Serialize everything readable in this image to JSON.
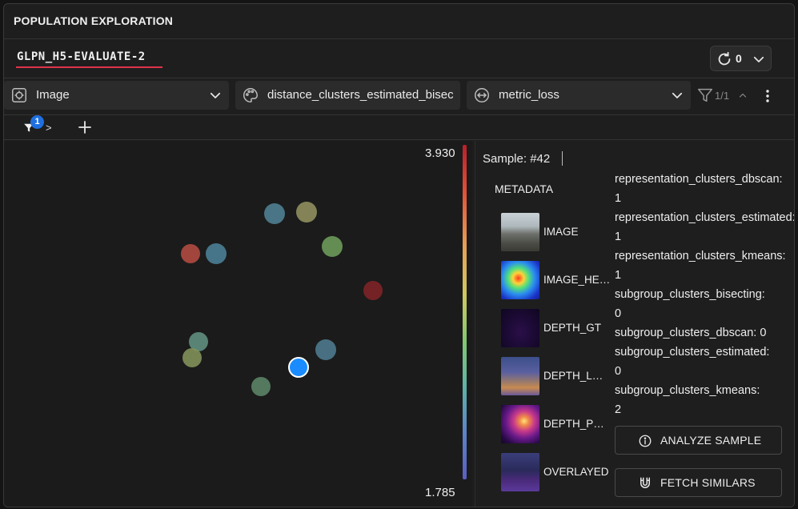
{
  "panel": {
    "title": "POPULATION EXPLORATION"
  },
  "tabs": [
    {
      "label": "GLPN_H5-EVALUATE-2",
      "active": true
    }
  ],
  "refresh": {
    "count": "0"
  },
  "toolbar": {
    "image_select": {
      "label": "Image",
      "icon": "image-settings-icon"
    },
    "color_select": {
      "label": "distance_clusters_estimated_bisecting",
      "icon": "palette-icon"
    },
    "metric_select": {
      "label": "metric_loss",
      "icon": "metric-icon"
    },
    "filter_count": "1/1"
  },
  "subbar": {
    "filter_badge": "1",
    "arrow": ">"
  },
  "colorbar": {
    "max": "3.930",
    "min": "1.785"
  },
  "scatter_points": [
    {
      "color": "#4f7f92"
    },
    {
      "color": "#8f8f5e"
    },
    {
      "color": "#b14a40"
    },
    {
      "color": "#4b7f96"
    },
    {
      "color": "#6d9a5a"
    },
    {
      "color": "#7e2427"
    },
    {
      "color": "#5f8f80"
    },
    {
      "color": "#82915a"
    },
    {
      "color": "#4e7a8e"
    },
    {
      "color": "#1a8cff",
      "selected": true
    },
    {
      "color": "#5b8466"
    }
  ],
  "detail": {
    "sample_label": "Sample: #42",
    "metadata_heading": "METADATA",
    "thumbnails": [
      {
        "label": "IMAGE"
      },
      {
        "label": "IMAGE_HEATMAP"
      },
      {
        "label": "DEPTH_GT"
      },
      {
        "label": "DEPTH_LOSS"
      },
      {
        "label": "DEPTH_PRED"
      },
      {
        "label": "OVERLAYED"
      }
    ],
    "metadata": [
      {
        "key": "representation_clusters_dbscan:",
        "value": "1"
      },
      {
        "key": "representation_clusters_estimated:",
        "value": "1"
      },
      {
        "key": "representation_clusters_kmeans:",
        "value": "1"
      },
      {
        "key": "subgroup_clusters_bisecting:",
        "value": "0"
      },
      {
        "key": "subgroup_clusters_dbscan: 0",
        "value": ""
      },
      {
        "key": "subgroup_clusters_estimated:",
        "value": "0"
      },
      {
        "key": "subgroup_clusters_kmeans:",
        "value": "2"
      }
    ],
    "analyze_label": "ANALYZE SAMPLE",
    "fetch_label": "FETCH SIMILARS"
  }
}
